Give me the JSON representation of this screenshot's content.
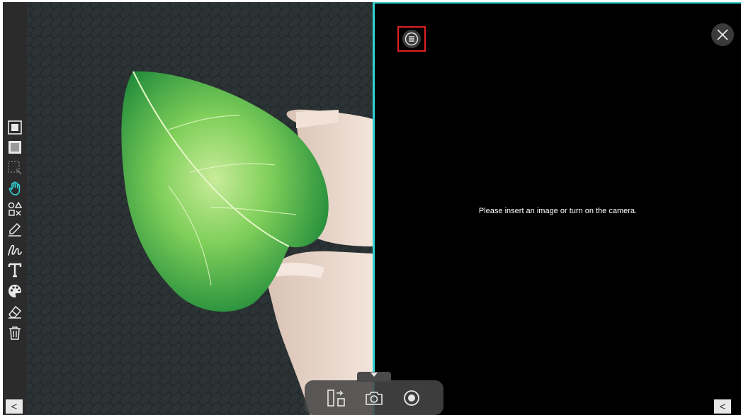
{
  "left_toolbar": {
    "tools": [
      {
        "icon": "stop-square-icon"
      },
      {
        "icon": "frame-square-icon"
      },
      {
        "icon": "selection-crop-icon"
      },
      {
        "icon": "hand-pan-icon"
      },
      {
        "icon": "shapes-icon"
      },
      {
        "icon": "pencil-icon"
      },
      {
        "icon": "freehand-curve-icon"
      },
      {
        "icon": "text-icon"
      },
      {
        "icon": "palette-icon"
      },
      {
        "icon": "eraser-icon"
      },
      {
        "icon": "trash-icon"
      }
    ],
    "active_tool": "hand-pan-icon",
    "active_color": "#31d2d2",
    "collapse_label": "<"
  },
  "right_panel": {
    "message": "Please insert an image or turn on the camera.",
    "collapse_label": "<"
  },
  "bottom_bar": {
    "buttons": [
      {
        "icon": "split-swap-icon"
      },
      {
        "icon": "camera-icon"
      },
      {
        "icon": "record-icon"
      }
    ]
  },
  "colors": {
    "divider": "#31d2d2",
    "highlight_box": "#e02020"
  }
}
